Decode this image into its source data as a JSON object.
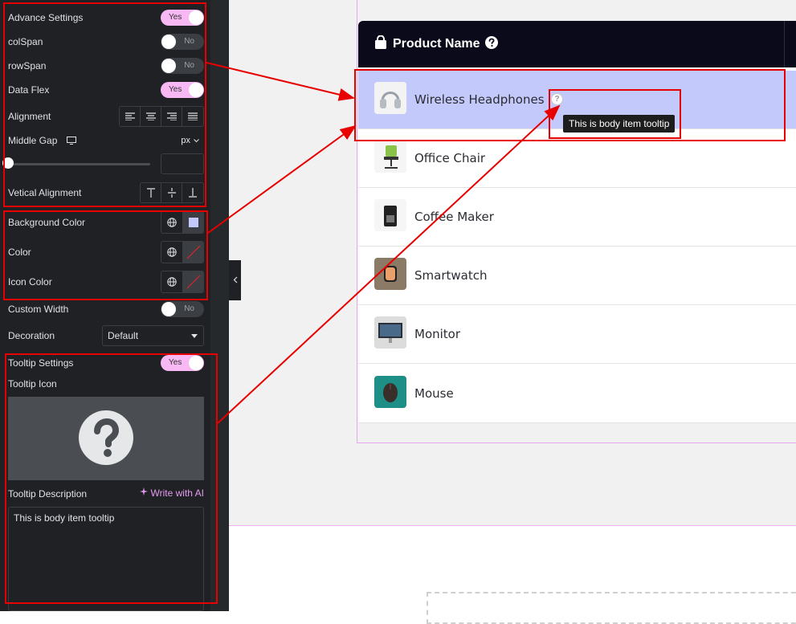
{
  "panel": {
    "advance_settings": {
      "label": "Advance Settings",
      "toggle": "Yes"
    },
    "colspan": {
      "label": "colSpan",
      "toggle": "No"
    },
    "rowspan": {
      "label": "rowSpan",
      "toggle": "No"
    },
    "data_flex": {
      "label": "Data Flex",
      "toggle": "Yes"
    },
    "alignment": {
      "label": "Alignment",
      "options": [
        "align-left-icon",
        "align-center-icon",
        "align-right-icon",
        "align-justify-icon"
      ]
    },
    "middle_gap": {
      "label": "Middle Gap",
      "unit": "px",
      "value": ""
    },
    "vertical_alignment": {
      "label": "Vetical Alignment",
      "options": [
        "align-top-icon",
        "align-middle-icon",
        "align-bottom-icon"
      ]
    },
    "background_color": {
      "label": "Background Color",
      "swatch": "#c4c9fb"
    },
    "color": {
      "label": "Color"
    },
    "icon_color": {
      "label": "Icon Color"
    },
    "custom_width": {
      "label": "Custom Width",
      "toggle": "No"
    },
    "decoration": {
      "label": "Decoration",
      "selected": "Default"
    },
    "tooltip_settings": {
      "label": "Tooltip Settings",
      "toggle": "Yes"
    },
    "tooltip_icon": {
      "label": "Tooltip Icon",
      "icon": "question-circle-icon"
    },
    "tooltip_description": {
      "label": "Tooltip Description",
      "ai_label": "Write with AI",
      "value": "This is body item tooltip"
    }
  },
  "table": {
    "header": "Product Name",
    "rows": [
      {
        "name": "Wireless Headphones",
        "thumb": "headphones"
      },
      {
        "name": "Office Chair",
        "thumb": "chair"
      },
      {
        "name": "Coffee Maker",
        "thumb": "coffee-maker"
      },
      {
        "name": "Smartwatch",
        "thumb": "smartwatch"
      },
      {
        "name": "Monitor",
        "thumb": "monitor"
      },
      {
        "name": "Mouse",
        "thumb": "mouse"
      }
    ],
    "tooltip": "This is body item tooltip"
  },
  "colors": {
    "toggle_on": "#f7b8f3",
    "active_row": "#c4c9fb",
    "header_bg": "#0b0a1a",
    "annotation": "#e80000",
    "accent": "#e49bf2"
  }
}
